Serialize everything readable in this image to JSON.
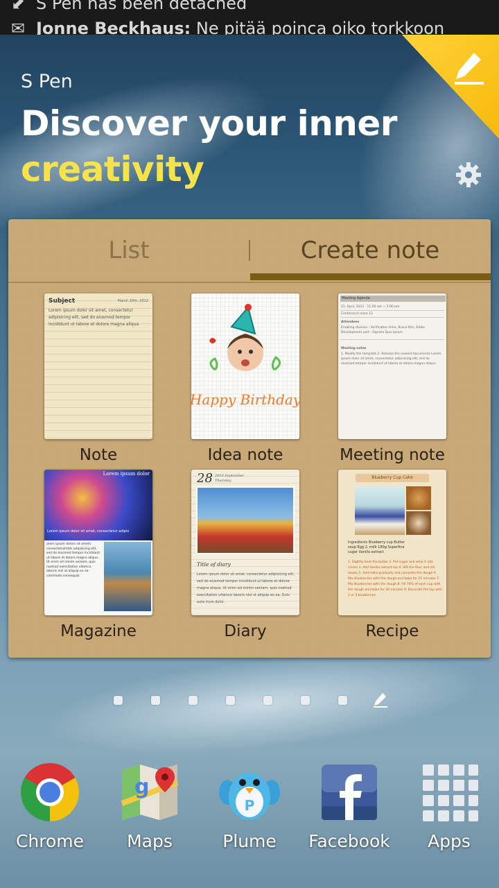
{
  "status_bar": {
    "notification_1": "S Pen has been detached",
    "notification_2_sender": "Jonne Beckhaus:",
    "notification_2_text": "Ne pitää poinca oiko torkkoon"
  },
  "widget": {
    "label": "S Pen",
    "headline_line1": "Discover your inner",
    "headline_line2": "creativity",
    "tabs": [
      {
        "label": "List",
        "selected": false
      },
      {
        "label": "Create note",
        "selected": true
      }
    ],
    "templates": [
      {
        "label": "Note"
      },
      {
        "label": "Idea note"
      },
      {
        "label": "Meeting note"
      },
      {
        "label": "Magazine"
      },
      {
        "label": "Diary"
      },
      {
        "label": "Recipe"
      }
    ],
    "thumbs": {
      "note_subject": "Subject",
      "note_date": "March 20th, 2012",
      "note_body": "Lorem ipsum dolor sit amet, consectetur adipisicing elit, sed do eiusmod tempor incididunt ut labore et dolore magna aliqua",
      "idea_caption": "Happy Birthday",
      "meeting_title": "Meeting Agenda",
      "meeting_date": "21. April, 2012",
      "meeting_time": "11:00 am ~ 2:00 pm",
      "meeting_location": "Conference room 12",
      "meeting_attendees": "Attendees",
      "meeting_body": "Enabling division : Verification Area, Bruce Kim, Eddie   Development part : Ognisia Quis Ipsum",
      "meeting_notes": "Meeting notes",
      "meeting_items": "1. Modify the template  2. Release the newest documents  Lorem ipsum dolor sit amet, consectetur adipisicing elit, sed do eiusmod tempor incididunt ut labore et dolore magna aliqua.",
      "magazine_title": "Lorem ipsum dolor",
      "magazine_caption": "Lorem ipsum dolor sit amet, consectetur adipis",
      "magazine_body": "orem ipsum dolors sit amets consectetuimtds adipisicing elit, sed do eiusmod tempor incididunt ut labore et dolore magna aliqua. Ut enim ad minim veniam, quis nostrud exercitation ullamco laboris nisi ut aliquip ex ea commodo consequat.",
      "diary_day": "28",
      "diary_month": "2010 September",
      "diary_weekday": "Thursday",
      "diary_title": "Title of diary",
      "diary_body": "Lorem ipsum dolor sit amet, consectetur adipisicing elit, sed do eiusmod tempor incididunt ut labore et dolore magna aliqua. Ut enim ad minim veniam, quis nostrud exercitation ullamco laboris nisi ut aliquip ex ea. Duis aute irure dolor.",
      "recipe_title": "Blueberry Cup Cake",
      "recipe_ingredients": "Ingredients  Blueberry cup  Butter soup  Egg 2, milk 180g  Superfine sugar  Vanilla extract",
      "recipe_steps": "1. Slightly beat the butter  2. Put sugar and whip it into cream  3. Add Vanilla extract tsp  4. Sift the flour and stir slowly  5. Add milks gradually and complete the dough  6. Mix Blueberries with the dough and bake for 25 minutes  7. Mix Blueberries with the dough  8. Fill 70% of each cup with the dough and bake for 20 minutes  9. Decorate the top with 2 or 3 blueberries"
    }
  },
  "page_indicator": {
    "count": 7,
    "current": 8
  },
  "dock": [
    {
      "label": "Chrome",
      "icon": "chrome-icon"
    },
    {
      "label": "Maps",
      "icon": "maps-icon"
    },
    {
      "label": "Plume",
      "icon": "plume-icon"
    },
    {
      "label": "Facebook",
      "icon": "facebook-icon"
    },
    {
      "label": "Apps",
      "icon": "apps-grid-icon"
    }
  ]
}
